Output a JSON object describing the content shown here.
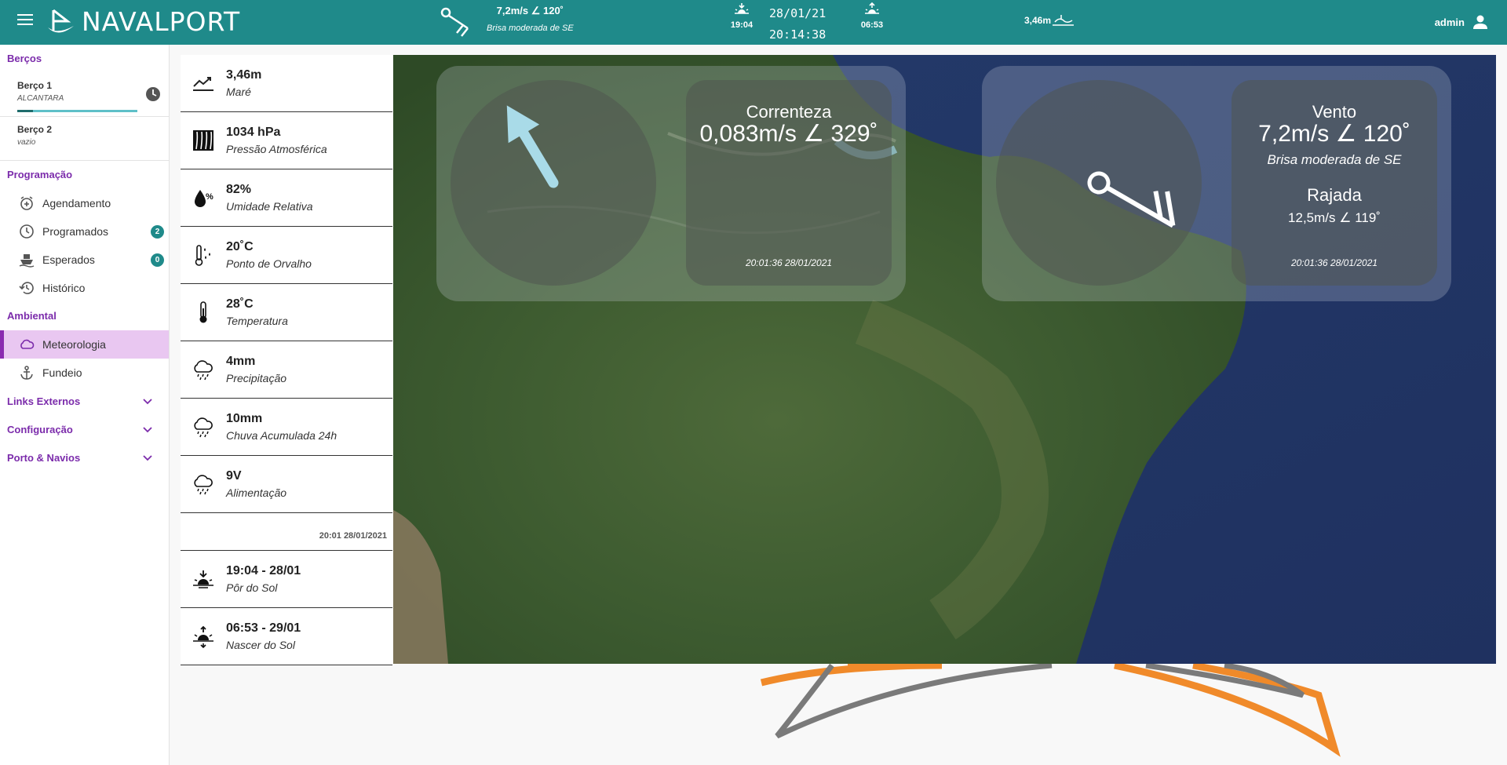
{
  "header": {
    "brand": "NAVALPORT",
    "wind_value": "7,2m/s ∠ 120˚",
    "wind_desc": "Brisa moderada de SE",
    "sunset_time": "19:04",
    "sunrise_time": "06:53",
    "date": "28/01/21",
    "time": "20:14:38",
    "tide": "3,46m",
    "user": "admin"
  },
  "sidebar": {
    "berths_title": "Berços",
    "berths": [
      {
        "name": "Berço 1",
        "status": "ALCANTARA"
      },
      {
        "name": "Berço 2",
        "status": "vazio"
      }
    ],
    "programming_title": "Programação",
    "programming": [
      {
        "label": "Agendamento",
        "icon": "calendar-plus-icon"
      },
      {
        "label": "Programados",
        "icon": "clock-icon",
        "badge": "2"
      },
      {
        "label": "Esperados",
        "icon": "ship-icon",
        "badge": "0"
      },
      {
        "label": "Histórico",
        "icon": "history-icon"
      }
    ],
    "environment_title": "Ambiental",
    "environment": [
      {
        "label": "Meteorologia",
        "icon": "cloud-icon"
      },
      {
        "label": "Fundeio",
        "icon": "anchor-icon"
      }
    ],
    "collapsibles": [
      "Links Externos",
      "Configuração",
      "Porto & Navios"
    ]
  },
  "measurements": [
    {
      "value": "3,46m",
      "label": "Maré",
      "icon": "tide-chart-icon"
    },
    {
      "value": "1034 hPa",
      "label": "Pressão Atmosférica",
      "icon": "pressure-icon"
    },
    {
      "value": "82%",
      "label": "Umidade Relativa",
      "icon": "humidity-icon"
    },
    {
      "value": "20˚C",
      "label": "Ponto de Orvalho",
      "icon": "dew-point-icon"
    },
    {
      "value": "28˚C",
      "label": "Temperatura",
      "icon": "thermometer-icon"
    },
    {
      "value": "4mm",
      "label": "Precipitação",
      "icon": "rain-cloud-icon"
    },
    {
      "value": "10mm",
      "label": "Chuva Acumulada 24h",
      "icon": "rain-cloud-icon"
    },
    {
      "value": "9V",
      "label": "Alimentação",
      "icon": "rain-cloud-icon"
    }
  ],
  "measurements_timestamp": "20:01 28/01/2021",
  "sun_events": [
    {
      "value": "19:04 - 28/01",
      "label": "Pôr do Sol",
      "icon": "sunset-icon"
    },
    {
      "value": "06:53 - 29/01",
      "label": "Nascer do Sol",
      "icon": "sunrise-icon"
    }
  ],
  "current": {
    "title": "Correnteza",
    "value": "0,083m/s ∠ 329˚",
    "timestamp": "20:01:36 28/01/2021",
    "direction_deg": 329,
    "arrow_color": "#a9dbe8"
  },
  "wind": {
    "title": "Vento",
    "value": "7,2m/s ∠ 120˚",
    "desc": "Brisa moderada de SE",
    "gust_title": "Rajada",
    "gust_value": "12,5m/s ∠ 119˚",
    "timestamp": "20:01:36 28/01/2021",
    "direction_deg": 120
  },
  "colors": {
    "header": "#1f8a8a",
    "accent": "#7b2bab",
    "active_bg": "#e9c7f1",
    "badge": "#1f8a8a"
  }
}
